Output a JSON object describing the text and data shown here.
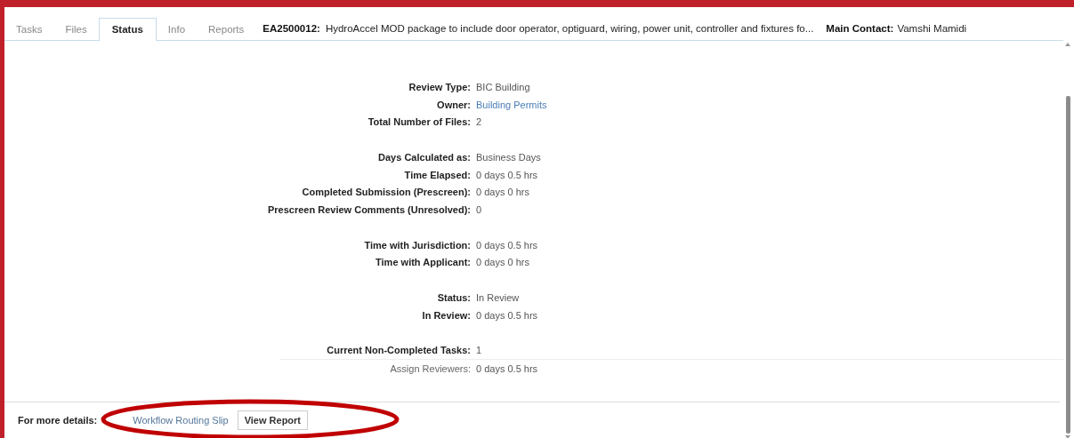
{
  "tabs": [
    {
      "label": "Tasks",
      "selected": false
    },
    {
      "label": "Files",
      "selected": false
    },
    {
      "label": "Status",
      "selected": true
    },
    {
      "label": "Info",
      "selected": false
    },
    {
      "label": "Reports",
      "selected": false
    }
  ],
  "header": {
    "record_id": "EA2500012:",
    "description": "HydroAccel MOD package to include door operator, optiguard, wiring, power unit, controller and fixtures fo...",
    "contact_label": "Main Contact:",
    "contact_name": "Vamshi Mamidi"
  },
  "groups": [
    {
      "rows": [
        {
          "label": "Review Type:",
          "value": "BIC Building",
          "kind": "field"
        },
        {
          "label": "Owner:",
          "value": "Building Permits",
          "kind": "link"
        },
        {
          "label": "Total Number of Files:",
          "value": "2",
          "kind": "field"
        }
      ]
    },
    {
      "rows": [
        {
          "label": "Days Calculated as:",
          "value": "Business Days",
          "kind": "field"
        },
        {
          "label": "Time Elapsed:",
          "value": "0 days 0.5 hrs",
          "kind": "field"
        },
        {
          "label": "Completed Submission (Prescreen):",
          "value": "0 days 0 hrs",
          "kind": "field"
        },
        {
          "label": "Prescreen Review Comments (Unresolved):",
          "value": "0",
          "kind": "field"
        }
      ]
    },
    {
      "rows": [
        {
          "label": "Time with Jurisdiction:",
          "value": "0 days 0.5 hrs",
          "kind": "field"
        },
        {
          "label": "Time with Applicant:",
          "value": "0 days 0 hrs",
          "kind": "field"
        }
      ]
    },
    {
      "rows": [
        {
          "label": "Status:",
          "value": "In Review",
          "kind": "field"
        },
        {
          "label": "In Review:",
          "value": "0 days 0.5 hrs",
          "kind": "field"
        }
      ]
    },
    {
      "rows": [
        {
          "label": "Current Non-Completed Tasks:",
          "value": "1",
          "kind": "field"
        },
        {
          "label": "Assign Reviewers:",
          "value": "0 days 0.5 hrs",
          "kind": "subtask"
        }
      ]
    }
  ],
  "footer": {
    "label": "For more details:",
    "link": "Workflow Routing Slip",
    "button": "View Report"
  }
}
